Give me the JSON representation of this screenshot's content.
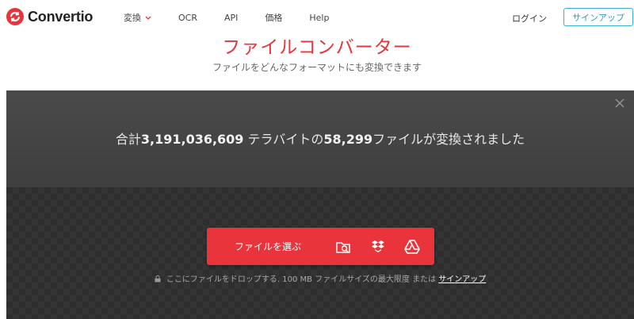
{
  "brand": {
    "name": "Convertio",
    "accent": "#e8343a"
  },
  "nav": {
    "items": [
      {
        "label": "変換",
        "dropdown": true
      },
      {
        "label": "OCR"
      },
      {
        "label": "API"
      },
      {
        "label": "価格"
      },
      {
        "label": "Help"
      }
    ],
    "login_label": "ログイン",
    "signup_label": "サインアップ"
  },
  "hero": {
    "title": "ファイルコンバーター",
    "subtitle": "ファイルをどんなフォーマットにも変換できます"
  },
  "stats": {
    "prefix": "合計",
    "terabytes": "3,191,036,609",
    "middle": " テラバイトの",
    "files": "58,299",
    "suffix": "ファイルが変換されました"
  },
  "upload": {
    "choose_label": "ファイルを選ぶ",
    "sources": [
      "folder-search-icon",
      "dropbox-icon",
      "google-drive-icon"
    ],
    "drop_note": "ここにファイルをドロップする. 100 MB ファイルサイズの最大限度 または ",
    "drop_note_link": "サインアップ"
  }
}
